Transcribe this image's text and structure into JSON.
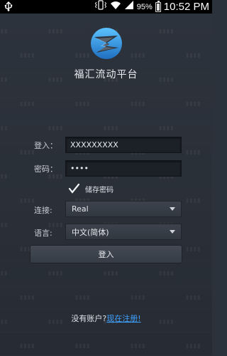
{
  "status_bar": {
    "battery_percent": "95%",
    "battery_level": 0.95,
    "time": "10:52 PM",
    "icons": [
      "usb-icon",
      "vibrate-icon",
      "wifi-icon",
      "signal-icon",
      "battery-icon"
    ]
  },
  "app": {
    "title": "福汇流动平台",
    "logo_icon": "fxcm-logo-icon"
  },
  "form": {
    "login_label": "登入：",
    "login_value": "XXXXXXXXX",
    "password_label": "密码：",
    "password_value": "••••",
    "remember_label": "储存密码",
    "remember_checked": true,
    "connection_label": "连接:",
    "connection_value": "Real",
    "language_label": "语言:",
    "language_value": "中文(简体)",
    "submit_label": "登入"
  },
  "footer": {
    "prompt": "没有账户?",
    "register_link": "现在注册!"
  },
  "colors": {
    "background": "#2c323b",
    "logo_blue": "#2a8fd8",
    "link": "#3fa1ff"
  }
}
